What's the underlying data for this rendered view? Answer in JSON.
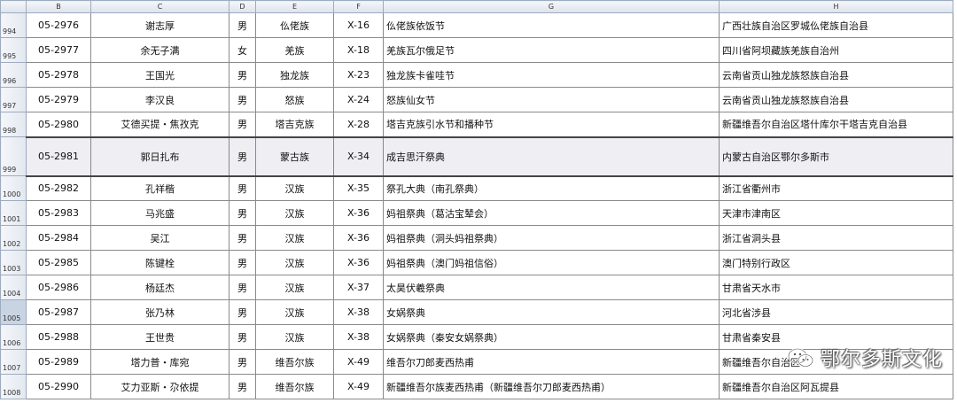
{
  "columns": [
    "B",
    "C",
    "D",
    "E",
    "F",
    "G",
    "H"
  ],
  "rows": [
    {
      "num": "994",
      "id": "05-2976",
      "name": "谢志厚",
      "sex": "男",
      "ethnic": "仫佬族",
      "code": "X-16",
      "festival": "仫佬族依饭节",
      "region": "广西壮族自治区罗城仫佬族自治县"
    },
    {
      "num": "995",
      "id": "05-2977",
      "name": "余无子满",
      "sex": "女",
      "ethnic": "羌族",
      "code": "X-18",
      "festival": "羌族瓦尔俄足节",
      "region": "四川省阿坝藏族羌族自治州"
    },
    {
      "num": "996",
      "id": "05-2978",
      "name": "王国光",
      "sex": "男",
      "ethnic": "独龙族",
      "code": "X-23",
      "festival": "独龙族卡雀哇节",
      "region": "云南省贡山独龙族怒族自治县"
    },
    {
      "num": "997",
      "id": "05-2979",
      "name": "李汉良",
      "sex": "男",
      "ethnic": "怒族",
      "code": "X-24",
      "festival": "怒族仙女节",
      "region": "云南省贡山独龙族怒族自治县"
    },
    {
      "num": "998",
      "id": "05-2980",
      "name": "艾德买提・焦孜克",
      "sex": "男",
      "ethnic": "塔吉克族",
      "code": "X-28",
      "festival": "塔吉克族引水节和播种节",
      "region": "新疆维吾尔自治区塔什库尔干塔吉克自治县"
    },
    {
      "num": "999",
      "id": "05-2981",
      "name": "郭日扎布",
      "sex": "男",
      "ethnic": "蒙古族",
      "code": "X-34",
      "festival": "成吉思汗祭典",
      "region": "内蒙古自治区鄂尔多斯市",
      "selected": true
    },
    {
      "num": "1000",
      "id": "05-2982",
      "name": "孔祥楷",
      "sex": "男",
      "ethnic": "汉族",
      "code": "X-35",
      "festival": "祭孔大典（南孔祭典）",
      "region": "浙江省衢州市"
    },
    {
      "num": "1001",
      "id": "05-2983",
      "name": "马兆盛",
      "sex": "男",
      "ethnic": "汉族",
      "code": "X-36",
      "festival": "妈祖祭典（葛沽宝辇会）",
      "region": "天津市津南区"
    },
    {
      "num": "1002",
      "id": "05-2984",
      "name": "吴江",
      "sex": "男",
      "ethnic": "汉族",
      "code": "X-36",
      "festival": "妈祖祭典（洞头妈祖祭典）",
      "region": "浙江省洞头县"
    },
    {
      "num": "1003",
      "id": "05-2985",
      "name": "陈键栓",
      "sex": "男",
      "ethnic": "汉族",
      "code": "X-36",
      "festival": "妈祖祭典（澳门妈祖信俗）",
      "region": "澳门特别行政区"
    },
    {
      "num": "1004",
      "id": "05-2986",
      "name": "杨廷杰",
      "sex": "男",
      "ethnic": "汉族",
      "code": "X-37",
      "festival": "太昊伏羲祭典",
      "region": "甘肃省天水市"
    },
    {
      "num": "1005",
      "id": "05-2987",
      "name": "张乃林",
      "sex": "男",
      "ethnic": "汉族",
      "code": "X-38",
      "festival": "女娲祭典",
      "region": "河北省涉县",
      "activeHeader": true
    },
    {
      "num": "1006",
      "id": "05-2988",
      "name": "王世贵",
      "sex": "男",
      "ethnic": "汉族",
      "code": "X-38",
      "festival": "女娲祭典（秦安女娲祭典）",
      "region": "甘肃省秦安县"
    },
    {
      "num": "1007",
      "id": "05-2989",
      "name": "塔力普・库宛",
      "sex": "男",
      "ethnic": "维吾尔族",
      "code": "X-49",
      "festival": "维吾尔刀郎麦西热甫",
      "region": "新疆维吾尔自治区"
    },
    {
      "num": "1008",
      "id": "05-2990",
      "name": "艾力亚斯・尕依提",
      "sex": "男",
      "ethnic": "维吾尔族",
      "code": "X-49",
      "festival": "新疆维吾尔族麦西热甫（新疆维吾尔刀郎麦西热甫）",
      "region": "新疆维吾尔自治区阿瓦提县"
    }
  ],
  "watermark": {
    "text": "鄂尔多斯文化",
    "icon": "wechat-icon"
  }
}
